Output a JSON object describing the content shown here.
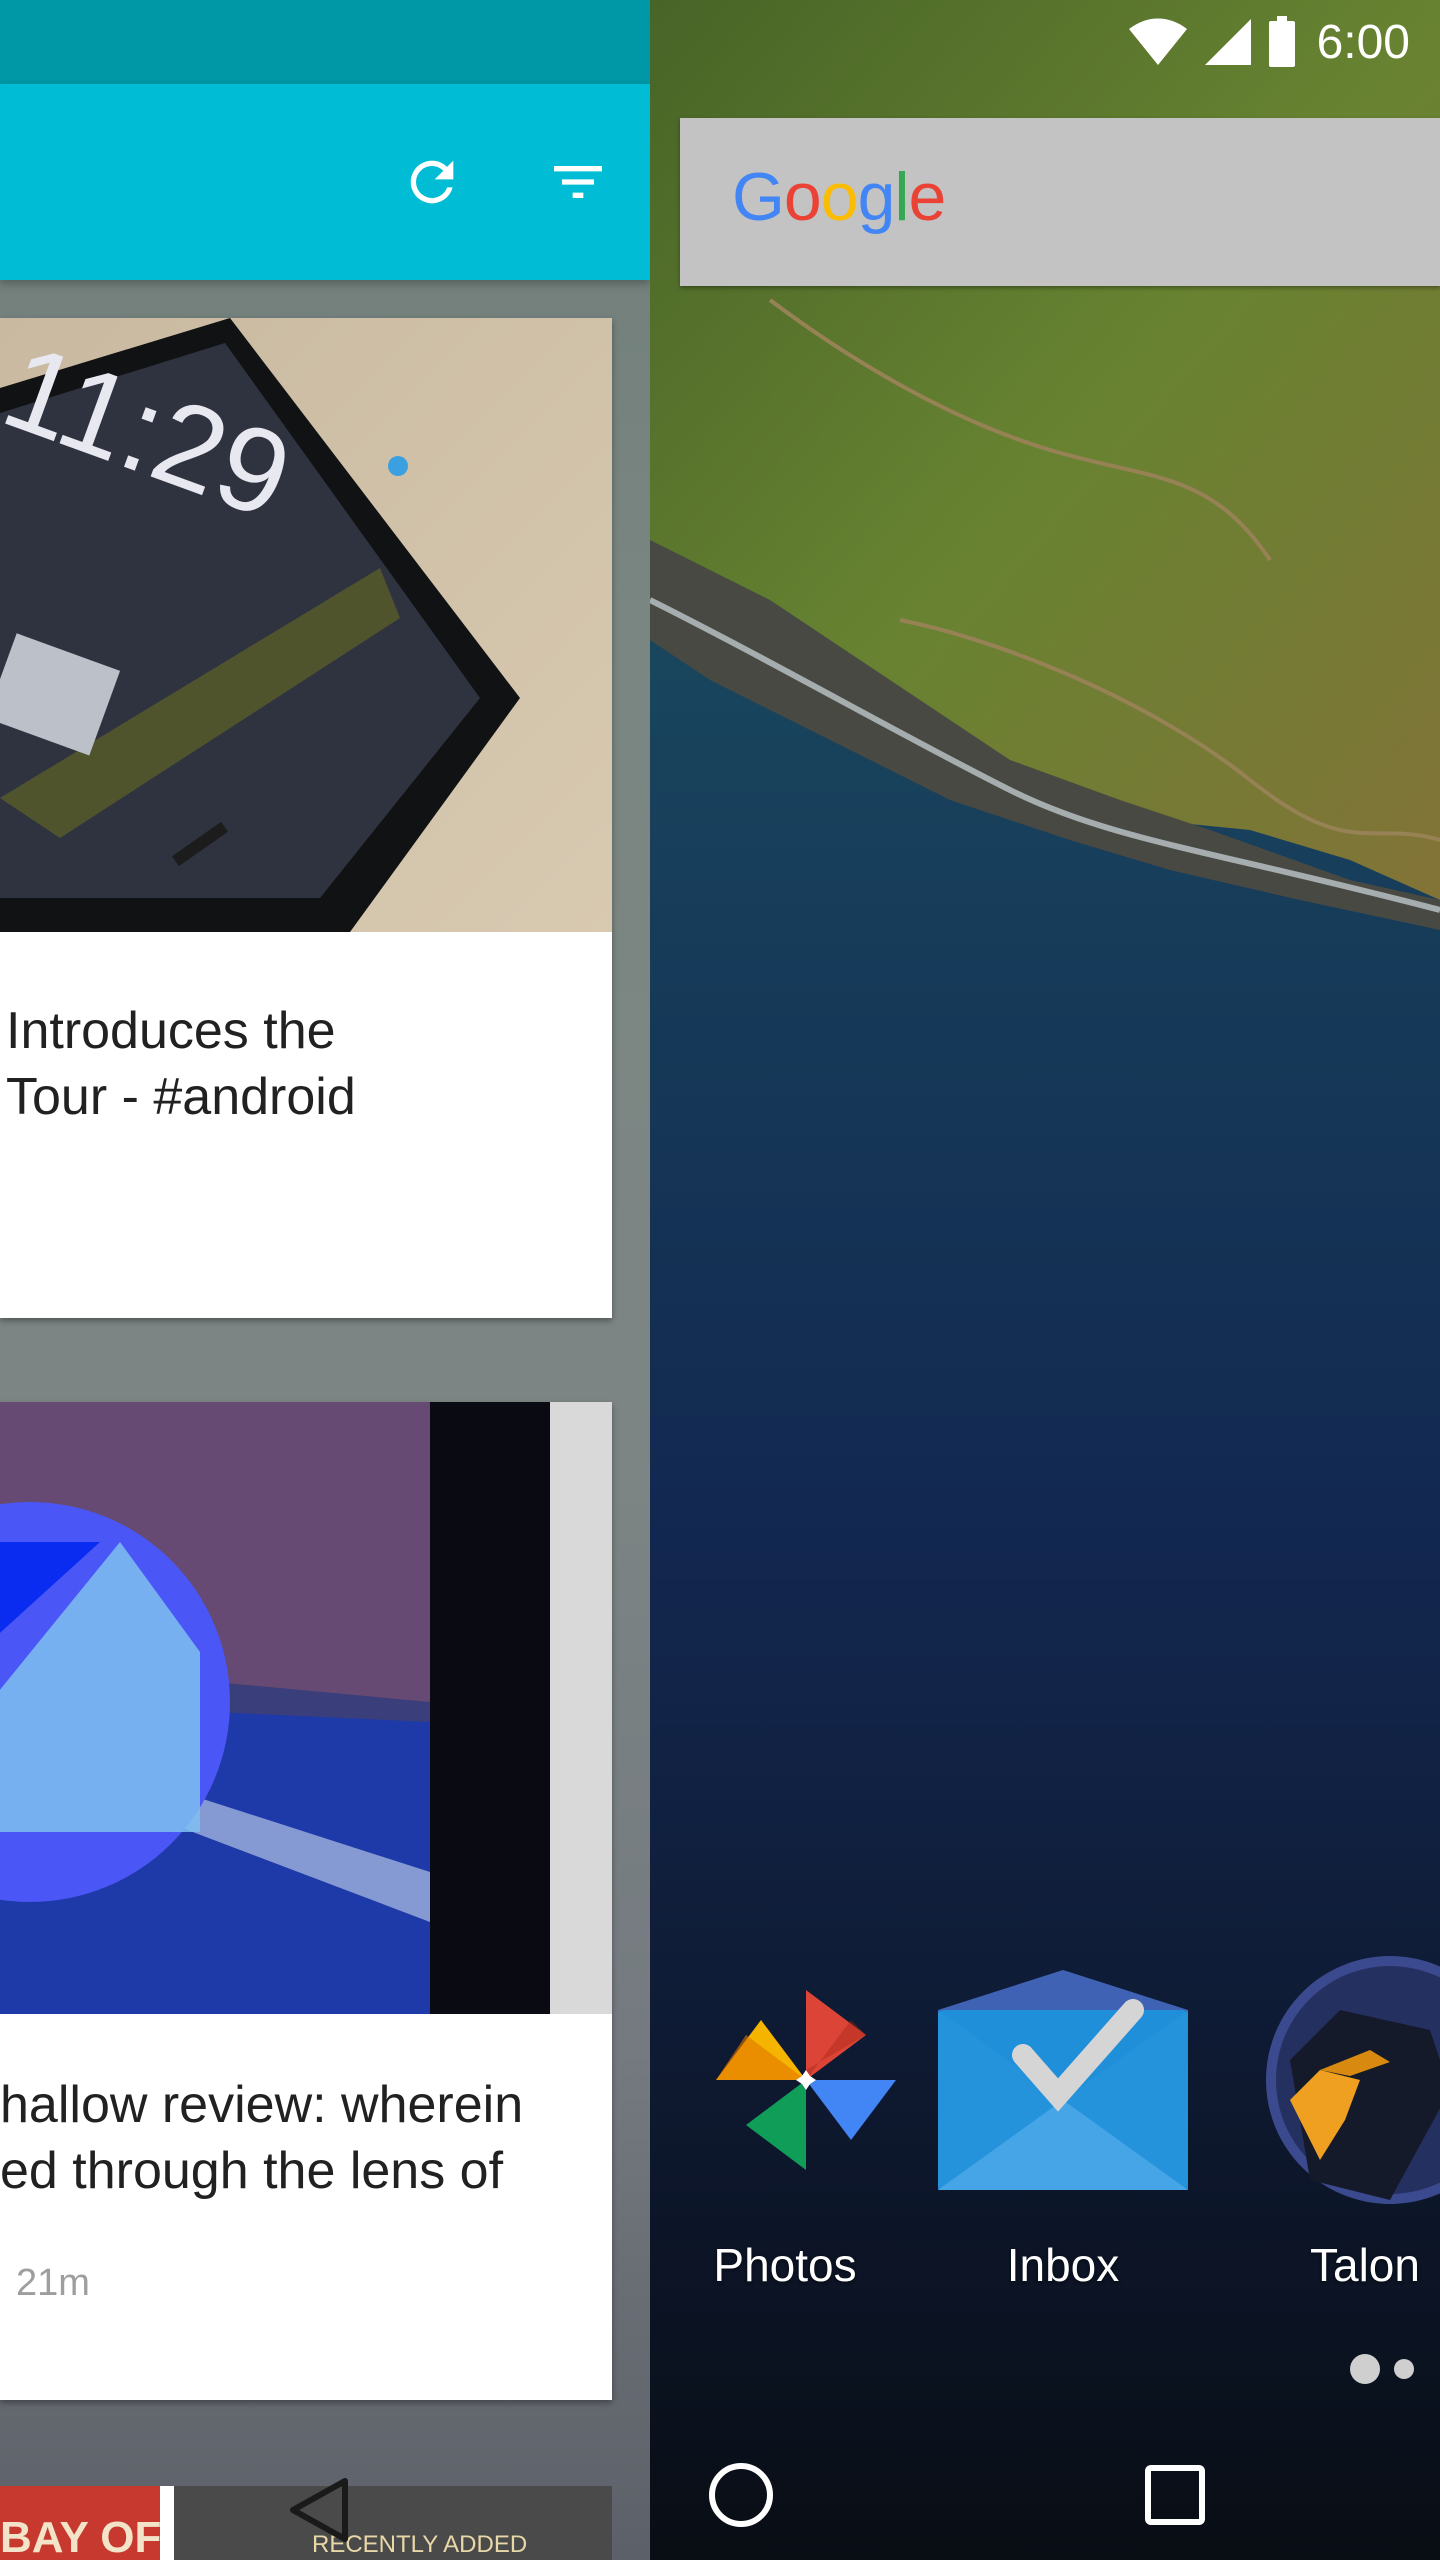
{
  "left_app": {
    "toolbar": {
      "refresh_icon": "refresh-icon",
      "filter_icon": "filter-icon",
      "accent": "#00bcd4",
      "statusbar_color": "#0097a7"
    },
    "cards": [
      {
        "title_lines": [
          "Introduces the",
          "Tour -  #android"
        ],
        "time": ""
      },
      {
        "title_lines": [
          "hallow review: wherein",
          "ed through the lens of"
        ],
        "time": "21m"
      }
    ],
    "card3_text": [
      "BAY OF",
      "RECENTLY ADDED"
    ]
  },
  "launcher": {
    "status": {
      "time": "6:00",
      "icons": [
        "wifi-icon",
        "signal-icon",
        "battery-icon"
      ]
    },
    "search": {
      "logo_letters": [
        "G",
        "o",
        "o",
        "g",
        "l",
        "e"
      ],
      "colors": [
        "#4285f4",
        "#ea4335",
        "#fbbc05",
        "#4285f4",
        "#34a853",
        "#ea4335"
      ]
    },
    "dock": [
      {
        "label": "Photos",
        "icon": "photos-icon"
      },
      {
        "label": "Inbox",
        "icon": "inbox-icon"
      },
      {
        "label": "Talon",
        "icon": "talon-icon"
      }
    ],
    "page_indicator": {
      "pages": 2,
      "current": 1
    }
  },
  "navigation": {
    "buttons": [
      "back-icon",
      "home-icon",
      "recents-icon"
    ]
  }
}
